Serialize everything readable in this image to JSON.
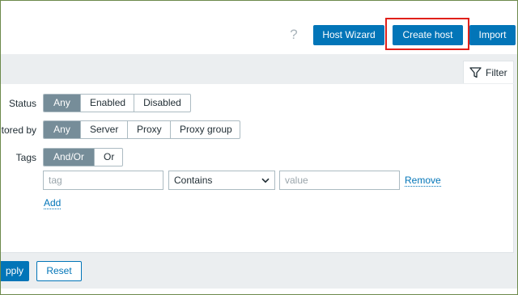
{
  "header": {
    "help_icon": "?",
    "host_wizard_label": "Host Wizard",
    "create_host_label": "Create host",
    "import_label": "Import"
  },
  "filter": {
    "tab_label": "Filter",
    "status": {
      "label": "Status",
      "options": [
        "Any",
        "Enabled",
        "Disabled"
      ],
      "selected": "Any"
    },
    "monitored_by": {
      "label": "tored by",
      "options": [
        "Any",
        "Server",
        "Proxy",
        "Proxy group"
      ],
      "selected": "Any"
    },
    "tags": {
      "label": "Tags",
      "options": [
        "And/Or",
        "Or"
      ],
      "selected": "And/Or",
      "row": {
        "tag_placeholder": "tag",
        "operator_value": "Contains",
        "value_placeholder": "value",
        "remove_label": "Remove"
      },
      "add_label": "Add"
    },
    "apply_label": "pply",
    "reset_label": "Reset"
  },
  "colors": {
    "primary": "#0275b8",
    "segment_selected": "#768d99",
    "highlight_box": "#e0201a",
    "panel_bg": "#ebeef0"
  }
}
